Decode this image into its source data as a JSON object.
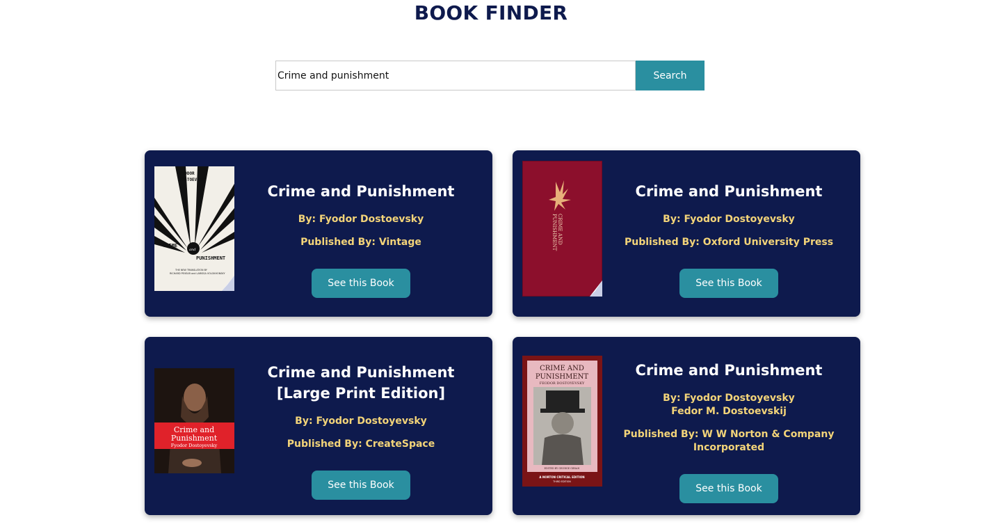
{
  "header": {
    "title": "BOOK FINDER"
  },
  "search": {
    "value": "Crime and punishment",
    "button_label": "Search"
  },
  "results": [
    {
      "title": "Crime and Punishment",
      "author_label": "By: Fyodor Dostoevsky",
      "publisher_label": "Published By: Vintage",
      "button_label": "See this Book",
      "cover_lines": [
        "FYODOR",
        "DOSTOEVSKY",
        "CRIME",
        "and",
        "PUNISHMENT",
        "THE NEW TRANSLATION BY",
        "RICHARD PEVEAR and LARISSA VOLOKHONSKY"
      ]
    },
    {
      "title": "Crime and Punishment",
      "author_label": "By: Fyodor Dostoyevsky",
      "publisher_label": "Published By: Oxford University Press",
      "button_label": "See this Book",
      "cover_lines": [
        "CRIME AND",
        "PUNISHMENT"
      ]
    },
    {
      "title": "Crime and Punishment [Large Print Edition]",
      "author_label": "By: Fyodor Dostoyevsky",
      "publisher_label": "Published By: CreateSpace",
      "button_label": "See this Book",
      "cover_lines": [
        "Crime and",
        "Punishment",
        "Fyodor Dostoyevsky"
      ]
    },
    {
      "title": "Crime and Punishment",
      "author_label": "By: Fyodor Dostoyevsky",
      "author_label_2": "Fedor M. Dostoevskij",
      "publisher_label": "Published By: W W Norton & Company",
      "publisher_label_2": "Incorporated",
      "button_label": "See this Book",
      "cover_lines": [
        "CRIME AND",
        "PUNISHMENT",
        "FEODOR DOSTOYEVSKY",
        "EDITED BY GEORGE GIBIAN",
        "A NORTON CRITICAL EDITION",
        "THIRD EDITION"
      ]
    }
  ],
  "colors": {
    "card_bg": "#0e1a4d",
    "accent": "#2a8fa0",
    "meta_text": "#f3d479",
    "title_text": "#0e1a4d"
  }
}
